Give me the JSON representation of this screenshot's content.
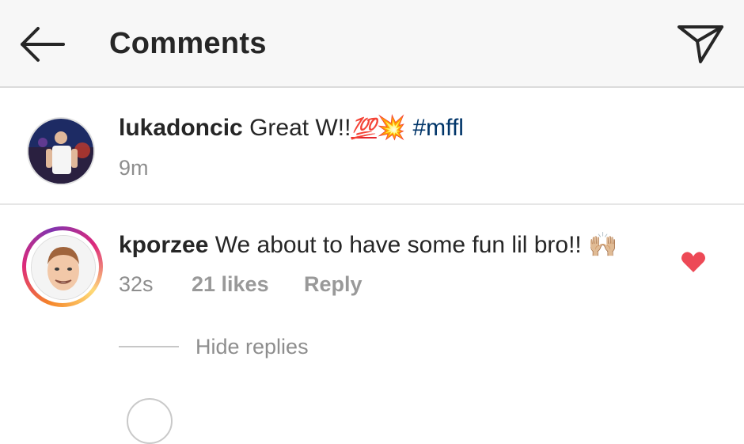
{
  "header": {
    "title": "Comments",
    "back_icon": "arrow-left-icon",
    "send_icon": "paper-plane-icon"
  },
  "caption": {
    "username": "lukadoncic",
    "text": "Great W!!",
    "emoji_1": "💯",
    "emoji_2": "💥",
    "hashtag": "#mffl",
    "time": "9m"
  },
  "comment": {
    "username": "kporzee",
    "text": "We about to have some fun lil bro!!",
    "emoji": "🙌🏼",
    "time": "32s",
    "likes": "21 likes",
    "reply_label": "Reply",
    "liked": true,
    "heart_color": "#ed4956"
  },
  "replies": {
    "toggle_label": "Hide replies"
  },
  "colors": {
    "header_bg": "#f7f7f7",
    "text": "#262626",
    "muted": "#8e8e8e",
    "hashtag": "#003569",
    "story_ring": "#dd2a7b"
  }
}
